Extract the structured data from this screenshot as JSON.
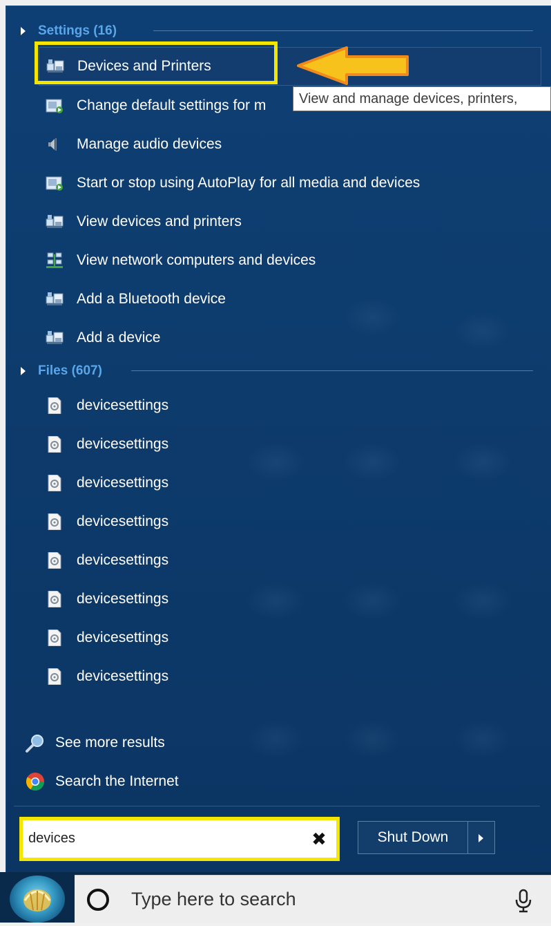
{
  "colors": {
    "panel_bg": "#0d3b6c",
    "section_header": "#5aa6ea",
    "highlight_annotation": "#f4e600",
    "arrow_fill": "#f7c21b",
    "arrow_outline": "#f08a1c"
  },
  "settings": {
    "header": "Settings (16)",
    "items": [
      {
        "label": "Devices and Printers",
        "icon": "devices-printers-icon"
      },
      {
        "label": "Change default settings for m",
        "icon": "autoplay-icon"
      },
      {
        "label": "Manage audio devices",
        "icon": "speaker-icon"
      },
      {
        "label": "Start or stop using AutoPlay for all media and devices",
        "icon": "autoplay-icon"
      },
      {
        "label": "View devices and printers",
        "icon": "devices-printers-icon"
      },
      {
        "label": "View network computers and devices",
        "icon": "network-icon"
      },
      {
        "label": "Add a Bluetooth device",
        "icon": "devices-printers-icon"
      },
      {
        "label": "Add a device",
        "icon": "devices-printers-icon"
      }
    ]
  },
  "tooltip": "View and manage devices, printers,",
  "files": {
    "header": "Files (607)",
    "items": [
      {
        "label": "devicesettings",
        "icon": "settings-file-icon"
      },
      {
        "label": "devicesettings",
        "icon": "settings-file-icon"
      },
      {
        "label": "devicesettings",
        "icon": "settings-file-icon"
      },
      {
        "label": "devicesettings",
        "icon": "settings-file-icon"
      },
      {
        "label": "devicesettings",
        "icon": "settings-file-icon"
      },
      {
        "label": "devicesettings",
        "icon": "settings-file-icon"
      },
      {
        "label": "devicesettings",
        "icon": "settings-file-icon"
      },
      {
        "label": "devicesettings",
        "icon": "settings-file-icon"
      }
    ]
  },
  "links": {
    "see_more": "See more results",
    "search_internet": "Search the Internet"
  },
  "search": {
    "value": "devices",
    "clear": "✖"
  },
  "shutdown": {
    "label": "Shut Down"
  },
  "taskbar": {
    "search_placeholder": "Type here to search"
  }
}
